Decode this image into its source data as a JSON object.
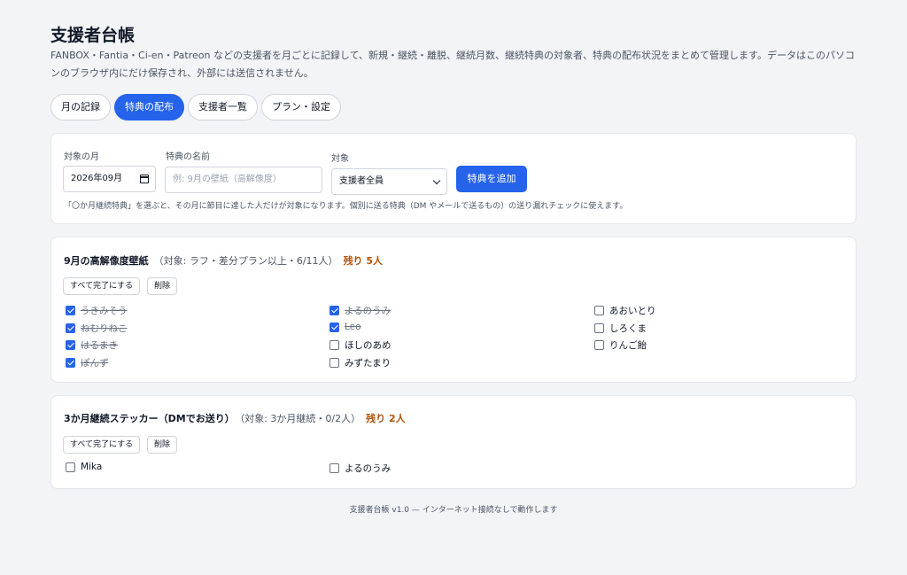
{
  "app": {
    "title": "支援者台帳",
    "description": "FANBOX・Fantia・Ci-en・Patreon などの支援者を月ごとに記録して、新規・継続・離脱、継続月数、継続特典の対象者、特典の配布状況をまとめて管理します。データはこのパソコンのブラウザ内にだけ保存され、外部には送信されません。"
  },
  "tabs": [
    {
      "label": "月の記録",
      "active": false
    },
    {
      "label": "特典の配布",
      "active": true
    },
    {
      "label": "支援者一覧",
      "active": false
    },
    {
      "label": "プラン・設定",
      "active": false
    }
  ],
  "form": {
    "month_label": "対象の月",
    "month_value": "2026年09月",
    "name_label": "特典の名前",
    "name_placeholder": "例: 9月の壁紙（高解像度）",
    "target_label": "対象",
    "target_value": "支援者全員",
    "add_button": "特典を追加",
    "hint": "「〇か月継続特典」を選ぶと、その月に節目に達した人だけが対象になります。個別に送る特典（DM やメールで送るもの）の送り漏れチェックに使えます。"
  },
  "benefits": [
    {
      "name": "9月の高解像度壁紙",
      "target": "（対象: ラフ・差分プラン以上・6/11人）",
      "remaining": "残り 5人",
      "complete_all": "すべて完了にする",
      "delete": "削除",
      "supporters": [
        {
          "name": "うきみそう",
          "done": true
        },
        {
          "name": "ねむりねこ",
          "done": true
        },
        {
          "name": "はるまき",
          "done": true
        },
        {
          "name": "ぽんず",
          "done": true
        },
        {
          "name": "よるのうみ",
          "done": true
        },
        {
          "name": "Leo",
          "done": true
        },
        {
          "name": "ほしのあめ",
          "done": false
        },
        {
          "name": "みずたまり",
          "done": false
        },
        {
          "name": "あおいとり",
          "done": false
        },
        {
          "name": "しろくま",
          "done": false
        },
        {
          "name": "りんご飴",
          "done": false
        }
      ]
    },
    {
      "name": "3か月継続ステッカー（DMでお送り）",
      "target": "（対象: 3か月継続・0/2人）",
      "remaining": "残り 2人",
      "complete_all": "すべて完了にする",
      "delete": "削除",
      "supporters": [
        {
          "name": "Mika",
          "done": false
        },
        {
          "name": "よるのうみ",
          "done": false
        }
      ]
    }
  ],
  "footer": "支援者台帳 v1.0 — インターネット接続なしで動作します",
  "colors": {
    "accent": "#2563eb",
    "remaining": "#b45309",
    "background": "#f3f4f6"
  }
}
